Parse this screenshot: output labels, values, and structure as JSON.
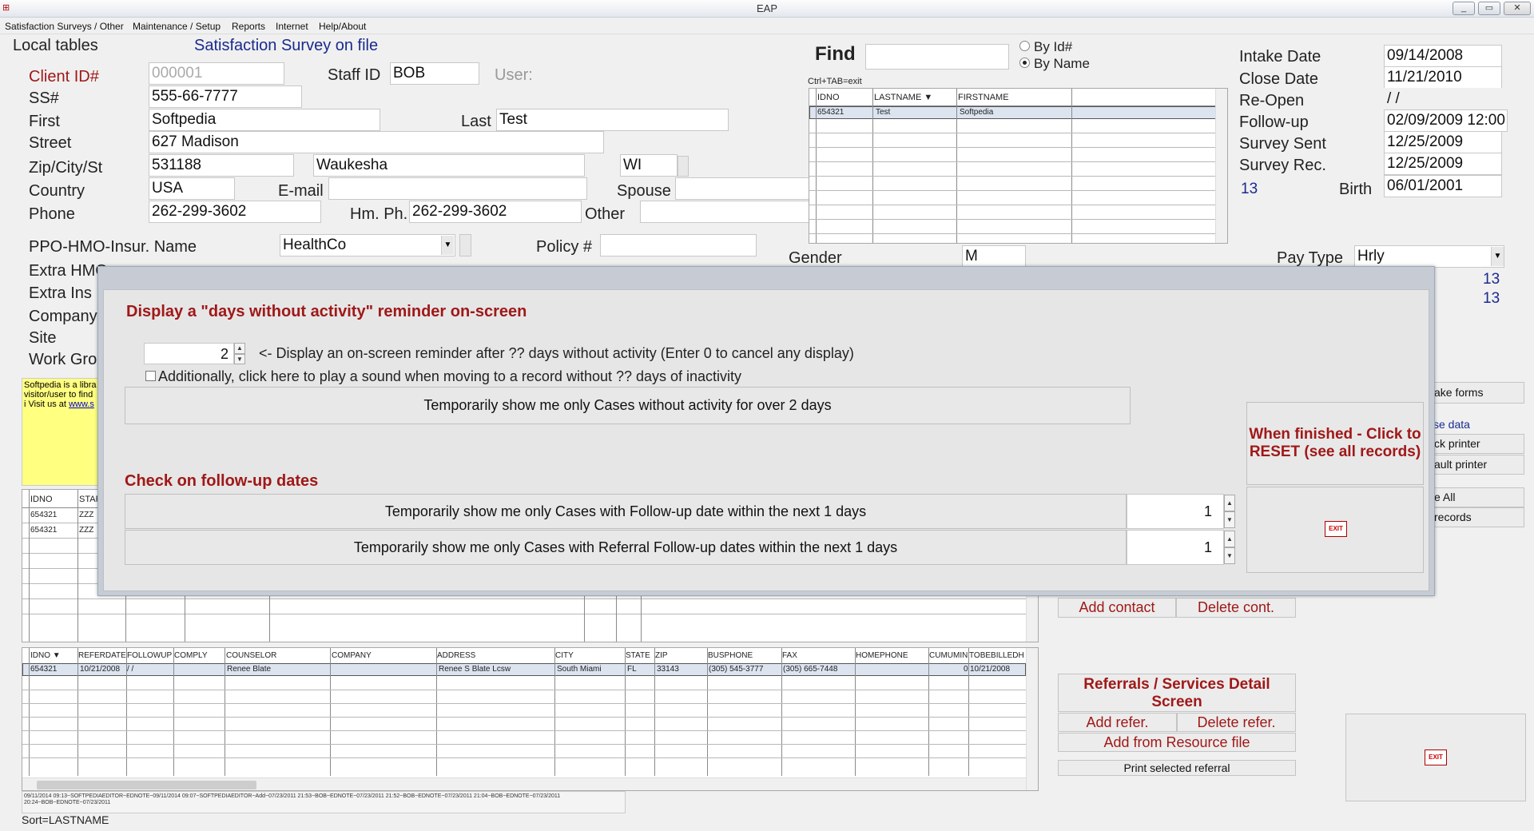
{
  "window": {
    "title": "EAP",
    "controls": [
      "_",
      "▭",
      "✕"
    ]
  },
  "menu": [
    "Satisfaction Surveys / Other",
    "Maintenance / Setup",
    "Reports",
    "Internet",
    "Help/About"
  ],
  "header": {
    "local_tables": "Local tables",
    "survey_link": "Satisfaction Survey on file",
    "find_label": "Find",
    "find_value": "",
    "by_id": "By Id#",
    "by_name": "By Name",
    "ctrl_tab": "Ctrl+TAB=exit"
  },
  "client": {
    "client_id_label": "Client ID#",
    "client_id": "000001",
    "staff_id_label": "Staff ID",
    "staff_id": "BOB",
    "user_label": "User:",
    "ss_label": "SS#",
    "ss": "555-66-7777",
    "first_label": "First",
    "first": "Softpedia",
    "last_label": "Last",
    "last": "Test",
    "street_label": "Street",
    "street": "627 Madison",
    "zip_label": "Zip/City/St",
    "zip": "531188",
    "city": "Waukesha",
    "state": "WI",
    "country_label": "Country",
    "country": "USA",
    "email_label": "E-mail",
    "email": "",
    "spouse_label": "Spouse",
    "spouse": "",
    "phone_label": "Phone",
    "phone": "262-299-3602",
    "hmph_label": "Hm. Ph.",
    "hmph": "262-299-3602",
    "other_label": "Other",
    "other": "",
    "insur_label": "PPO-HMO-Insur. Name",
    "insur": "HealthCo",
    "policy_label": "Policy #",
    "policy": "",
    "extra_hmo": "Extra HMO",
    "extra_ins": "Extra Ins",
    "company": "Company",
    "site": "Site",
    "work_group": "Work Gro",
    "gender_label": "Gender",
    "gender": "M",
    "paytype_label": "Pay Type",
    "paytype": "Hrly"
  },
  "dates": {
    "intake_label": "Intake Date",
    "intake": "09/14/2008",
    "close_label": "Close Date",
    "close": "11/21/2010",
    "reopen_label": "Re-Open",
    "reopen": " / /",
    "followup_label": "Follow-up",
    "followup": "02/09/2009 12:00",
    "sent_label": "Survey Sent",
    "sent": "12/25/2009",
    "rec_label": "Survey Rec.",
    "rec": "12/25/2009",
    "age": "13",
    "birth_label": "Birth",
    "birth": "06/01/2001",
    "n1": "13",
    "n2": "13"
  },
  "lookup_grid": {
    "headers": [
      "IDNO",
      "LASTNAME ▼",
      "FIRSTNAME"
    ],
    "row": [
      "654321",
      "Test",
      "Softpedia"
    ]
  },
  "note": {
    "text": "Softpedia is a libra visitor/user to find i Visit us at",
    "link": "www.s"
  },
  "case_grid": {
    "headers": [
      "IDNO",
      "STAF"
    ],
    "rows": [
      [
        "654321",
        "ZZZ"
      ],
      [
        "654321",
        "ZZZ"
      ]
    ]
  },
  "referral_grid": {
    "headers": [
      "IDNO ▼",
      "REFERDATE",
      "FOLLOWUP",
      "COMPLY",
      "COUNSELOR",
      "COMPANY",
      "ADDRESS",
      "CITY",
      "STATE",
      "ZIP",
      "BUSPHONE",
      "FAX",
      "HOMEPHONE",
      "CUMUMIN",
      "TOBEBILLEDH"
    ],
    "row": [
      "654321",
      "10/21/2008",
      " / /",
      "",
      "Renee Blate",
      "",
      "Renee S Blate Lcsw",
      "South Miami",
      "FL",
      "33143",
      "(305) 545-3777",
      "(305) 665-7448",
      "",
      "0",
      "10/21/2008"
    ]
  },
  "log": "09/11/2014 09:13~SOFTPEDIAEDITOR~EDNOTE~09/11/2014 09:07~SOFTPEDIAEDITOR~Add~07/23/2011 21:53~BOB~EDNOTE~07/23/2011 21:52~BOB~EDNOTE~07/23/2011 21:04~BOB~EDNOTE~07/23/2011 20:24~BOB~EDNOTE~07/23/2011",
  "sort": "Sort=LASTNAME",
  "right_buttons": {
    "make_forms": "ake forms",
    "use_data": "se data",
    "pick_printer": "ck printer",
    "default_printer": "ault printer",
    "see_all": "e All",
    "records": "records"
  },
  "contacts": {
    "add": "Add contact",
    "delete": "Delete cont."
  },
  "referrals": {
    "title": "Referrals / Services Detail Screen",
    "add": "Add refer.",
    "delete": "Delete refer.",
    "resource": "Add from Resource file",
    "print": "Print selected referral"
  },
  "exit_label": "EXIT",
  "dialog": {
    "h1": "Display a \"days without activity\" reminder on-screen",
    "days": "2",
    "days_text": "<- Display an on-screen reminder after ?? days without activity   (Enter 0 to cancel any display)",
    "sound_text": "Additionally, click here to play a sound when moving to a record without ?? days of inactivity",
    "show_inactive": "Temporarily show me only Cases without activity for over 2 days",
    "h2": "Check on follow-up dates",
    "followup_btn": "Temporarily show me only Cases with Follow-up date within the next 1 days",
    "followup_days": "1",
    "referral_btn": "Temporarily show me only Cases with Referral Follow-up dates within the next 1 days",
    "referral_days": "1",
    "reset": "When finished - Click to RESET (see all records)"
  },
  "colors": {
    "label_red": "#a01818",
    "link_blue": "#1a2a8e",
    "note_yellow": "#ffff80"
  }
}
